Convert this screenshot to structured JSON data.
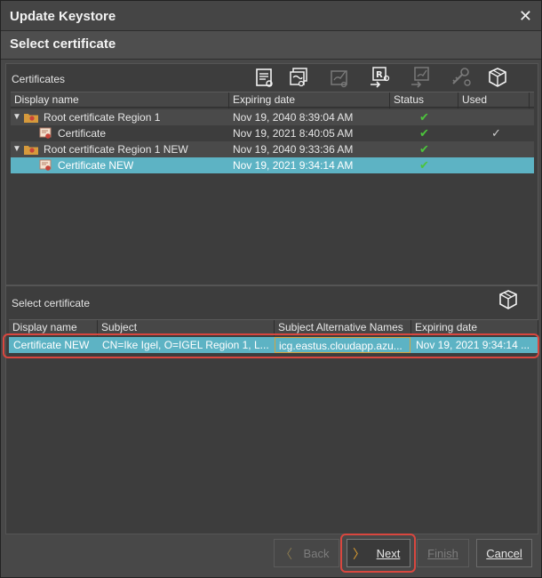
{
  "window": {
    "title": "Update Keystore",
    "close_glyph": "✕",
    "subtitle": "Select certificate"
  },
  "certificates_panel": {
    "title": "Certificates",
    "toolbar_icons": [
      "document-icon",
      "certificate-stack-icon",
      "sign-certificate-icon",
      "request-certificate-icon",
      "export-certificate-icon",
      "key-icon",
      "box-icon"
    ],
    "columns": [
      "Display name",
      "Expiring date",
      "Status",
      "Used"
    ],
    "rows": [
      {
        "name": "Root certificate Region 1",
        "expiring": "Nov 19, 2040 8:39:04 AM",
        "status": "✔",
        "used": ""
      },
      {
        "name": "Certificate",
        "expiring": "Nov 19, 2021 8:40:05 AM",
        "status": "✔",
        "used": "✓"
      },
      {
        "name": "Root certificate Region 1 NEW",
        "expiring": "Nov 19, 2040 9:33:36 AM",
        "status": "✔",
        "used": ""
      },
      {
        "name": "Certificate NEW",
        "expiring": "Nov 19, 2021 9:34:14 AM",
        "status": "✔",
        "used": ""
      }
    ]
  },
  "select_panel": {
    "title": "Select certificate",
    "columns": [
      "Display name",
      "Subject",
      "Subject Alternative Names",
      "Expiring date"
    ],
    "rows": [
      {
        "name": "Certificate NEW",
        "subject": "CN=Ike Igel, O=IGEL Region 1, L...",
        "san": "icg.eastus.cloudapp.azu...",
        "expiring": "Nov 19, 2021 9:34:14 ..."
      }
    ]
  },
  "buttons": {
    "back": "Back",
    "next": "Next",
    "finish": "Finish",
    "cancel": "Cancel"
  },
  "colors": {
    "selection": "#5db3c4",
    "highlight_outline": "#d9473f",
    "status_green": "#4cc43c"
  }
}
